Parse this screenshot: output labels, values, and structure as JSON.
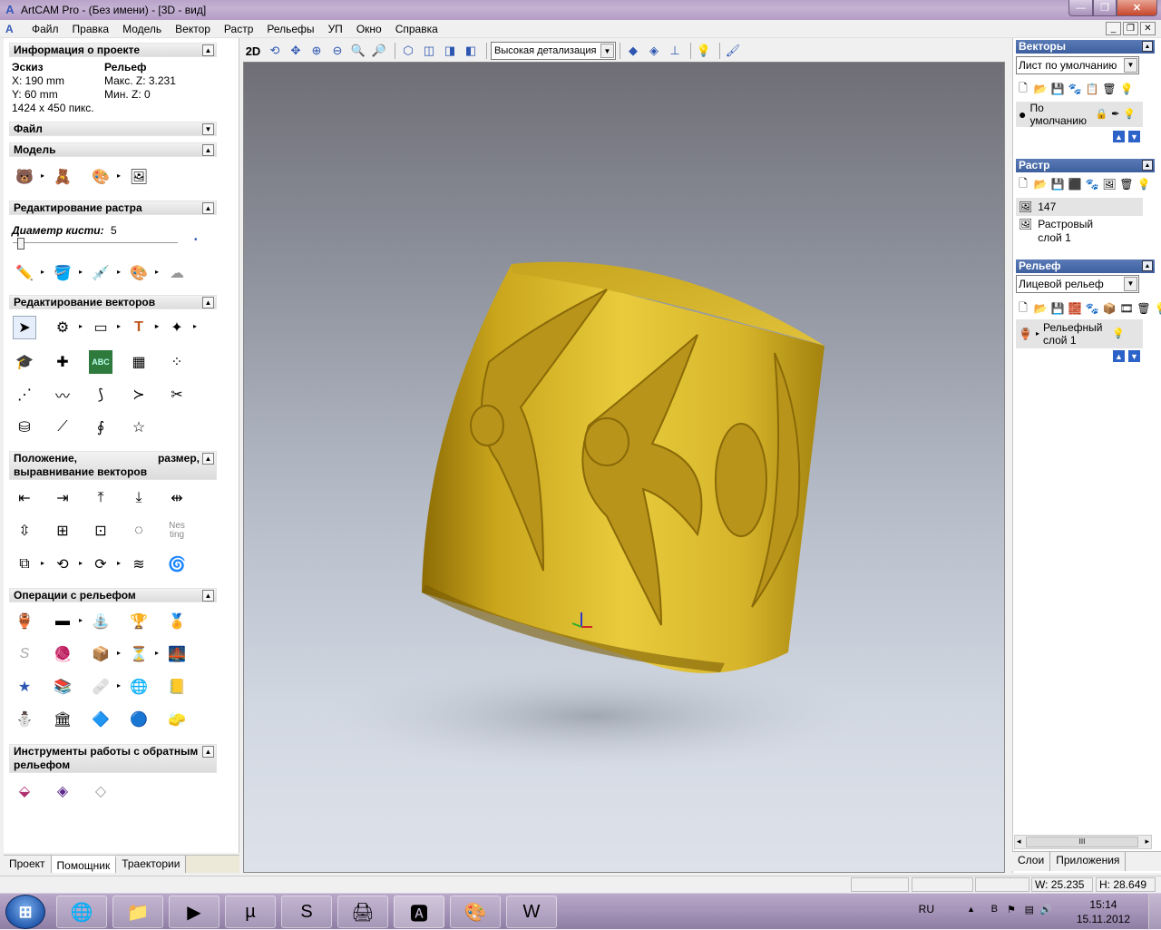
{
  "window": {
    "title": "ArtCAM Pro - (Без имени) - [3D - вид]",
    "app_icon_glyph": "A"
  },
  "menu": [
    "Файл",
    "Правка",
    "Модель",
    "Вектор",
    "Растр",
    "Рельефы",
    "УП",
    "Окно",
    "Справка"
  ],
  "left": {
    "project_info": {
      "header": "Информация о проекте",
      "sketch_label": "Эскиз",
      "x": "X: 190 mm",
      "y": "Y: 60 mm",
      "pixels": "1424 x 450 пикс.",
      "relief_label": "Рельеф",
      "max_z": "Макс. Z: 3.231",
      "min_z": "Мин. Z: 0"
    },
    "file_header": "Файл",
    "model_header": "Модель",
    "raster_edit_header": "Редактирование растра",
    "brush_label": "Диаметр кисти:",
    "brush_value": "5",
    "brush_level": 0.03,
    "vector_edit_header": "Редактирование векторов",
    "align_header_left": "Положение,",
    "align_header_right": "размер,",
    "align_header_line2": "выравнивание векторов",
    "relief_ops_header": "Операции с рельефом",
    "reverse_tools_header_left": "Инструменты работы с обратным",
    "reverse_tools_header_line2": "рельефом",
    "nesting_text": "Nes ting",
    "abc_text": "ABC",
    "tabs": [
      "Проект",
      "Помощник",
      "Траектории"
    ]
  },
  "toolbar3d": {
    "btn_2d": "2D",
    "detail_select": "Высокая детализация"
  },
  "right": {
    "vectors": {
      "header": "Векторы",
      "sheet_select": "Лист по умолчанию",
      "layer_name": "По умолчанию"
    },
    "raster": {
      "header": "Растр",
      "count": "147",
      "layer_name": "Растровый слой 1"
    },
    "relief": {
      "header": "Рельеф",
      "select": "Лицевой рельеф",
      "layer_name": "Рельефный слой 1"
    },
    "tabs": [
      "Слои",
      "Приложения"
    ],
    "scroll_grip": "III"
  },
  "status": {
    "w": "W: 25.235",
    "h": "H: 28.649"
  },
  "taskbar": {
    "lang": "RU",
    "time": "15:14",
    "date": "15.11.2012",
    "apps": [
      "ie-icon",
      "explorer-icon",
      "media-icon",
      "utorrent-icon",
      "skype-icon",
      "app-icon",
      "artcam-icon",
      "paint-icon",
      "word-icon"
    ]
  },
  "colors": {
    "model_gold": "#d6b42a",
    "title_bar": "#b9a3c9",
    "header_blue": "#3d5f9f"
  }
}
